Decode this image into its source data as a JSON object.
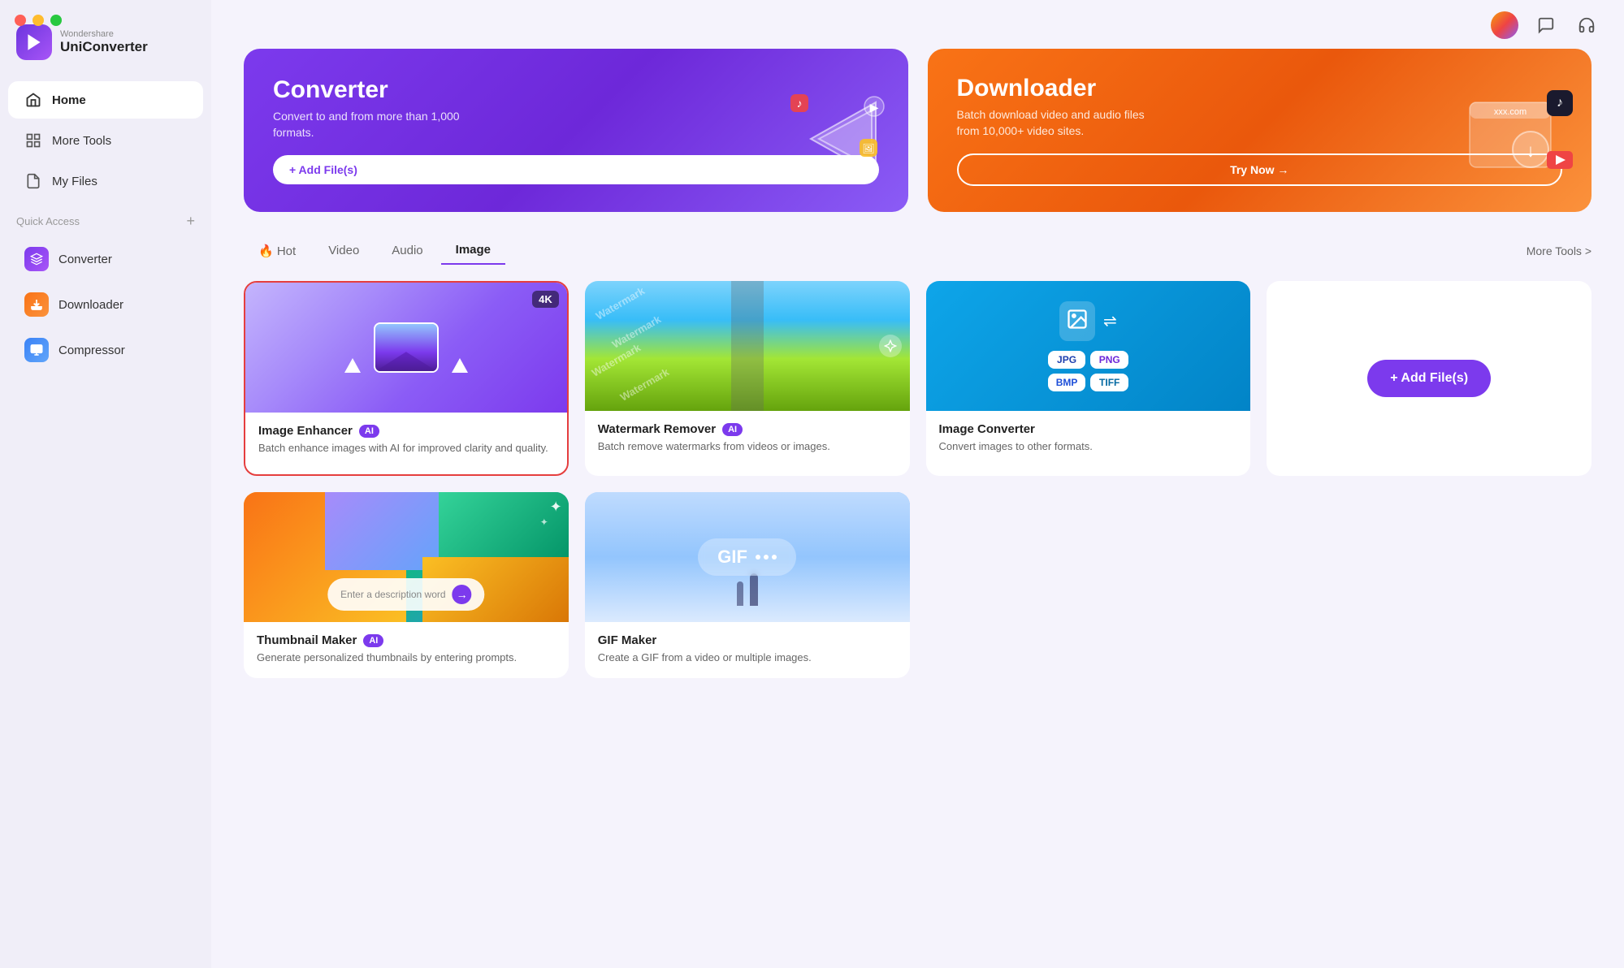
{
  "app": {
    "brand": "Wondershare",
    "name": "UniConverter"
  },
  "titlebar": {
    "dots": [
      "red",
      "yellow",
      "green"
    ]
  },
  "sidebar": {
    "nav": [
      {
        "id": "home",
        "label": "Home",
        "icon": "home-icon",
        "active": true
      },
      {
        "id": "more-tools",
        "label": "More Tools",
        "icon": "grid-icon",
        "active": false
      },
      {
        "id": "my-files",
        "label": "My Files",
        "icon": "file-icon",
        "active": false
      }
    ],
    "quick_access_label": "Quick Access",
    "quick_access_plus": "+",
    "sub_items": [
      {
        "id": "converter",
        "label": "Converter",
        "icon": "converter-icon",
        "style": "purple"
      },
      {
        "id": "downloader",
        "label": "Downloader",
        "icon": "download-icon",
        "style": "orange"
      },
      {
        "id": "compressor",
        "label": "Compressor",
        "icon": "compress-icon",
        "style": "blue"
      }
    ]
  },
  "banners": [
    {
      "id": "converter-banner",
      "title": "Converter",
      "desc": "Convert to and from more than 1,000 formats.",
      "btn_label": "+ Add File(s)",
      "style": "purple"
    },
    {
      "id": "downloader-banner",
      "title": "Downloader",
      "desc": "Batch download video and audio files from 10,000+ video sites.",
      "btn_label": "Try Now →",
      "style": "orange"
    }
  ],
  "tabs": {
    "items": [
      {
        "id": "hot",
        "label": "🔥 Hot",
        "active": false
      },
      {
        "id": "video",
        "label": "Video",
        "active": false
      },
      {
        "id": "audio",
        "label": "Audio",
        "active": false
      },
      {
        "id": "image",
        "label": "Image",
        "active": true
      }
    ],
    "more_tools_label": "More Tools >"
  },
  "tools": [
    {
      "id": "image-enhancer",
      "title": "Image Enhancer",
      "ai": true,
      "desc": "Batch enhance images with AI for improved clarity and quality.",
      "thumb_type": "enhancer",
      "selected": true
    },
    {
      "id": "watermark-remover",
      "title": "Watermark Remover",
      "ai": true,
      "desc": "Batch remove watermarks from videos or images.",
      "thumb_type": "watermark",
      "selected": false
    },
    {
      "id": "image-converter",
      "title": "Image Converter",
      "ai": false,
      "desc": "Convert images to other formats.",
      "thumb_type": "converter-img",
      "selected": false
    },
    {
      "id": "add-files",
      "title": "Add Files",
      "ai": false,
      "desc": "",
      "thumb_type": "add-files",
      "selected": false
    },
    {
      "id": "thumbnail-maker",
      "title": "Thumbnail Maker",
      "ai": true,
      "desc": "Generate personalized thumbnails by entering prompts.",
      "thumb_type": "thumbnail",
      "selected": false
    },
    {
      "id": "gif-maker",
      "title": "GIF Maker",
      "ai": false,
      "desc": "Create a GIF from a video or multiple images.",
      "thumb_type": "gif",
      "selected": false
    }
  ],
  "add_files_btn": "+ Add File(s)",
  "formats": [
    "JPG",
    "PNG",
    "BMP",
    "TIFF"
  ],
  "watermark_texts": [
    "Watermark",
    "Watermark",
    "Watermark"
  ],
  "badge_4k": "4K",
  "desc_placeholder": "Enter a description word",
  "gif_label": "GIF"
}
